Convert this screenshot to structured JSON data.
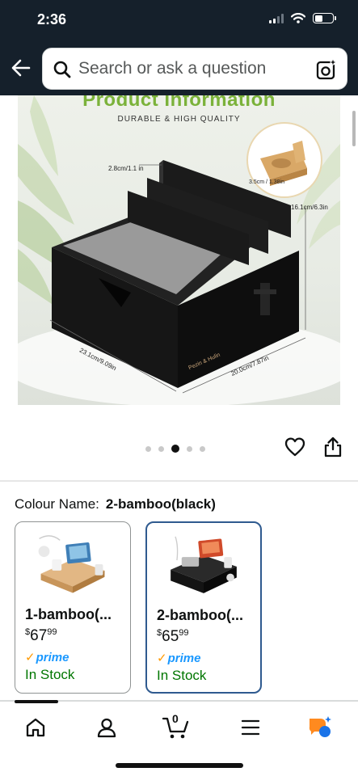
{
  "status_bar": {
    "time": "2:36"
  },
  "search": {
    "placeholder": "Search or ask a question"
  },
  "product_image": {
    "title": "Product Information",
    "subtitle": "DURABLE & HIGH QUALITY",
    "dimensions": {
      "slot_gap": "2.8cm/1.1 in",
      "holder": "3.5cm / 1.38in",
      "height": "16.1cm/6.3in",
      "length": "23.1cm/9.09in",
      "width": "20.0cm/7.87in"
    },
    "brand": "Pezin & Hulin"
  },
  "carousel": {
    "count": 5,
    "active_index": 2
  },
  "colour": {
    "label": "Colour Name:",
    "value": "2-bamboo(black)"
  },
  "variants": [
    {
      "name": "1-bamboo(...",
      "currency": "$",
      "price_whole": "67",
      "price_fraction": "99",
      "prime": "prime",
      "stock": "In Stock",
      "selected": false
    },
    {
      "name": "2-bamboo(...",
      "currency": "$",
      "price_whole": "65",
      "price_fraction": "99",
      "prime": "prime",
      "stock": "In Stock",
      "selected": true
    }
  ],
  "nav": {
    "cart_count": "0"
  },
  "colors": {
    "header_bg": "#15202b",
    "prime_blue": "#1a98ff",
    "in_stock_green": "#007600",
    "selected_border": "#2f5a8f",
    "prime_check": "#ff9900",
    "title_green": "#7bb23a"
  }
}
